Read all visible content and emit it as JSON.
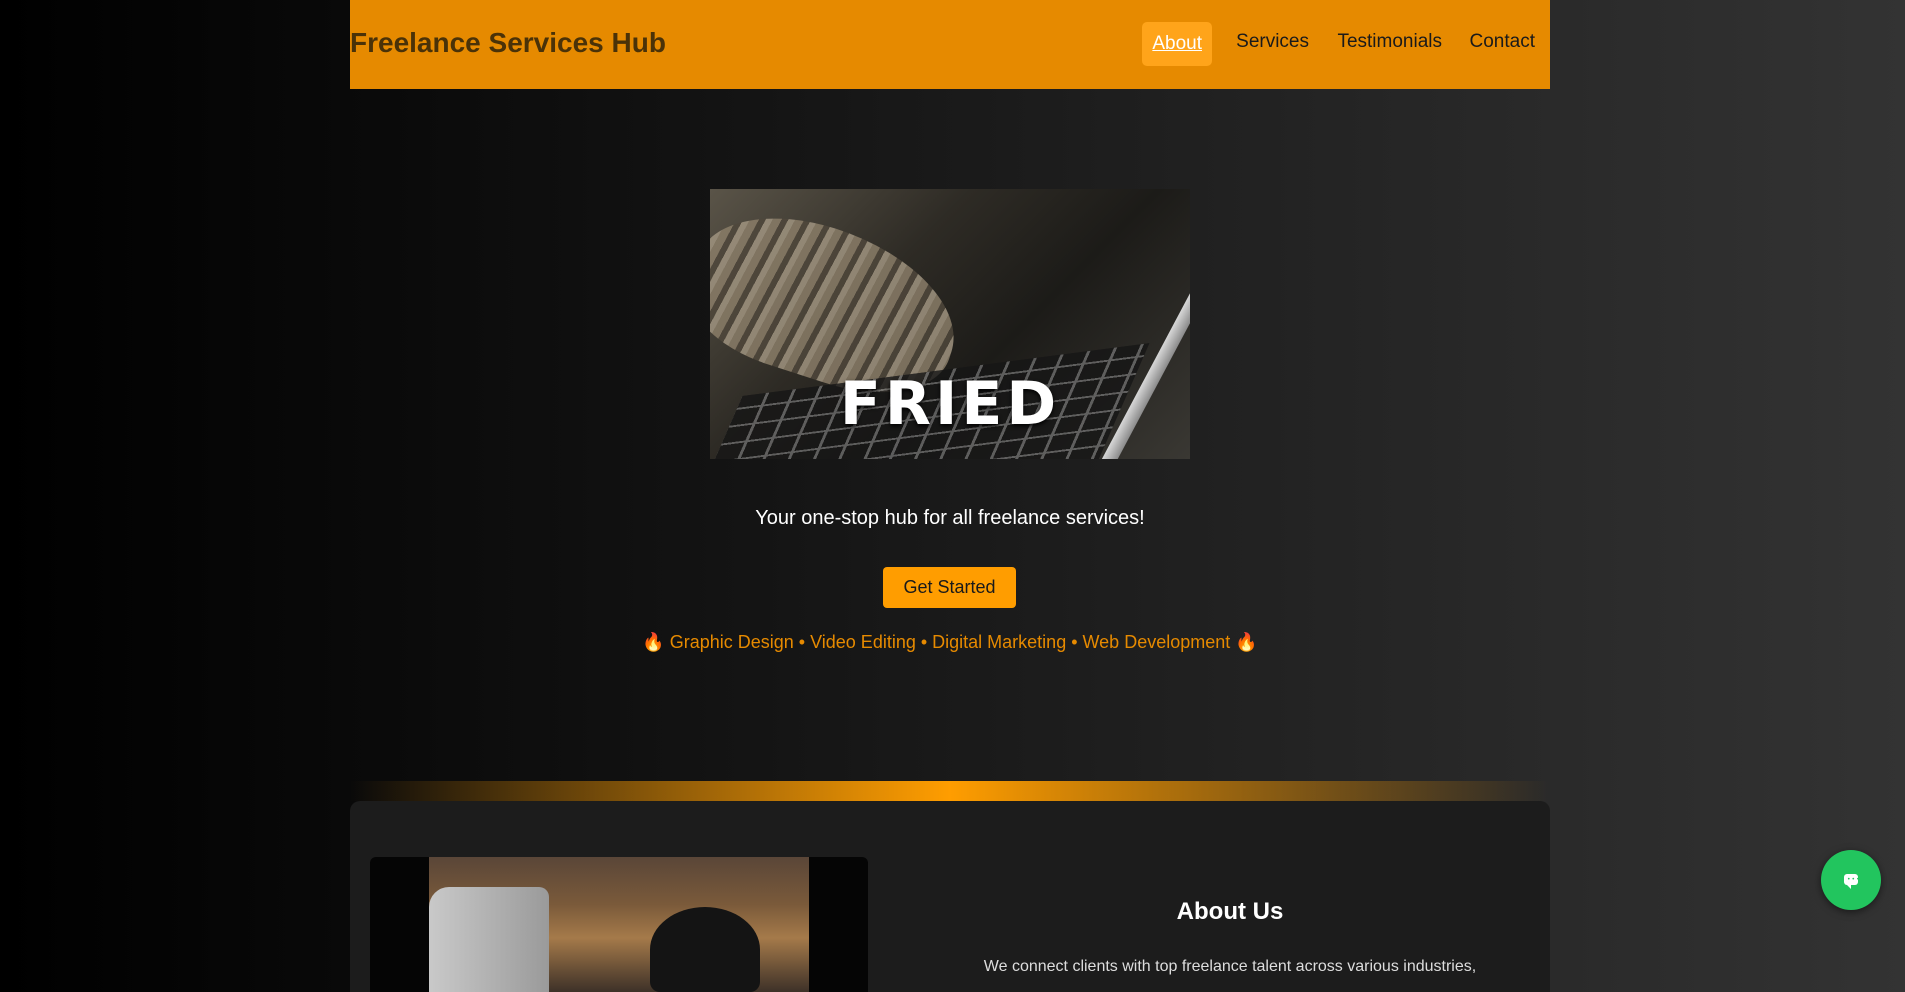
{
  "header": {
    "title": "Freelance Services Hub",
    "nav": [
      {
        "label": "About",
        "active": true
      },
      {
        "label": "Services",
        "active": false
      },
      {
        "label": "Testimonials",
        "active": false
      },
      {
        "label": "Contact",
        "active": false
      }
    ]
  },
  "hero": {
    "image_caption": "FRIED",
    "tagline": "Your one-stop hub for all freelance services!",
    "cta_label": "Get Started",
    "services_emoji": "🔥",
    "services_text": "Graphic Design • Video Editing • Digital Marketing • Web Development"
  },
  "about": {
    "title": "About Us",
    "text": "We connect clients with top freelance talent across various industries,"
  },
  "chat": {
    "icon": "chat-bubble-icon"
  },
  "colors": {
    "header_bg": "#e68a00",
    "accent": "#ff9d00",
    "chat_bg": "#22c55e"
  }
}
